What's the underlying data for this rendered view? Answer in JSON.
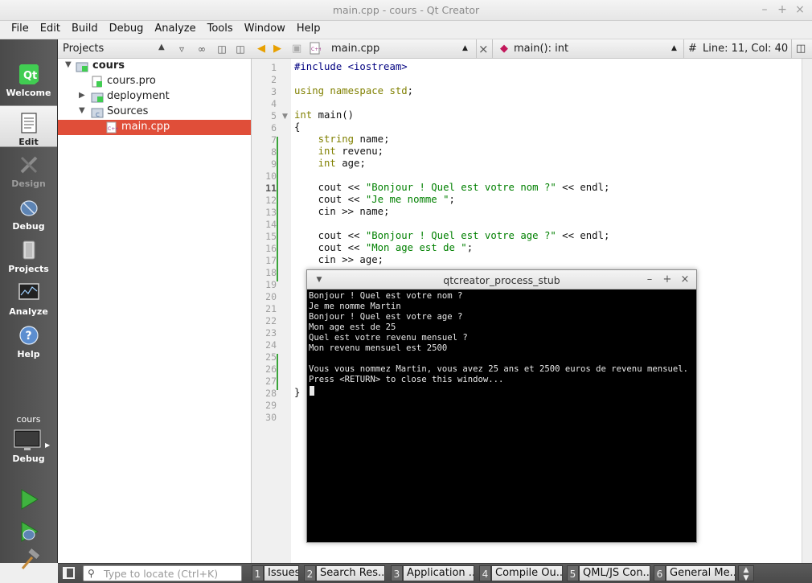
{
  "window": {
    "title": "main.cpp - cours - Qt Creator"
  },
  "menu": [
    {
      "label": "File"
    },
    {
      "label": "Edit"
    },
    {
      "label": "Build"
    },
    {
      "label": "Debug"
    },
    {
      "label": "Analyze"
    },
    {
      "label": "Tools"
    },
    {
      "label": "Window"
    },
    {
      "label": "Help"
    }
  ],
  "modes": {
    "welcome": "Welcome",
    "edit": "Edit",
    "design": "Design",
    "debug": "Debug",
    "projects": "Projects",
    "analyze": "Analyze",
    "help": "Help"
  },
  "kit": {
    "project": "cours",
    "build": "Debug"
  },
  "projects_panel": {
    "title": "Projects",
    "tree": [
      {
        "label": "cours",
        "icon": "qt-project-icon",
        "expanded": true
      },
      {
        "label": "cours.pro",
        "icon": "qt-pro-file-icon"
      },
      {
        "label": "deployment",
        "icon": "qt-folder-icon",
        "expanded": false
      },
      {
        "label": "Sources",
        "icon": "sources-folder-icon",
        "expanded": true
      },
      {
        "label": "main.cpp",
        "icon": "cpp-file-icon",
        "selected": true
      }
    ]
  },
  "editor_toolbar": {
    "file": "main.cpp",
    "symbol": "main(): int",
    "hash": "#",
    "position": "Line: 11, Col: 40"
  },
  "editor": {
    "current_line": 11,
    "lines": [
      {
        "n": "1",
        "parts": [
          {
            "t": "#include <iostream>",
            "c": "pp"
          }
        ]
      },
      {
        "n": "2",
        "parts": []
      },
      {
        "n": "3",
        "parts": [
          {
            "t": "using namespace std",
            "c": "kw"
          },
          {
            "t": ";",
            "c": ""
          }
        ]
      },
      {
        "n": "4",
        "parts": []
      },
      {
        "n": "5",
        "parts": [
          {
            "t": "int",
            "c": "kw"
          },
          {
            "t": " main()",
            "c": ""
          }
        ]
      },
      {
        "n": "6",
        "parts": [
          {
            "t": "{",
            "c": ""
          }
        ]
      },
      {
        "n": "7",
        "parts": [
          {
            "t": "    ",
            "c": ""
          },
          {
            "t": "string",
            "c": "kw"
          },
          {
            "t": " name;",
            "c": ""
          }
        ]
      },
      {
        "n": "8",
        "parts": [
          {
            "t": "    ",
            "c": ""
          },
          {
            "t": "int",
            "c": "kw"
          },
          {
            "t": " revenu;",
            "c": ""
          }
        ]
      },
      {
        "n": "9",
        "parts": [
          {
            "t": "    ",
            "c": ""
          },
          {
            "t": "int",
            "c": "kw"
          },
          {
            "t": " age;",
            "c": ""
          }
        ]
      },
      {
        "n": "10",
        "parts": []
      },
      {
        "n": "11",
        "parts": [
          {
            "t": "    cout << ",
            "c": ""
          },
          {
            "t": "\"Bonjour ! Quel est votre nom ?\"",
            "c": "str"
          },
          {
            "t": " << endl;",
            "c": ""
          }
        ]
      },
      {
        "n": "12",
        "parts": [
          {
            "t": "    cout << ",
            "c": ""
          },
          {
            "t": "\"Je me nomme \"",
            "c": "str"
          },
          {
            "t": ";",
            "c": ""
          }
        ]
      },
      {
        "n": "13",
        "parts": [
          {
            "t": "    cin >> name;",
            "c": ""
          }
        ]
      },
      {
        "n": "14",
        "parts": []
      },
      {
        "n": "15",
        "parts": [
          {
            "t": "    cout << ",
            "c": ""
          },
          {
            "t": "\"Bonjour ! Quel est votre age ?\"",
            "c": "str"
          },
          {
            "t": " << endl;",
            "c": ""
          }
        ]
      },
      {
        "n": "16",
        "parts": [
          {
            "t": "    cout << ",
            "c": ""
          },
          {
            "t": "\"Mon age est de \"",
            "c": "str"
          },
          {
            "t": ";",
            "c": ""
          }
        ]
      },
      {
        "n": "17",
        "parts": [
          {
            "t": "    cin >> age;",
            "c": ""
          }
        ]
      },
      {
        "n": "18",
        "parts": []
      },
      {
        "n": "19",
        "parts": []
      },
      {
        "n": "20",
        "parts": []
      },
      {
        "n": "21",
        "parts": []
      },
      {
        "n": "22",
        "parts": []
      },
      {
        "n": "23",
        "parts": []
      },
      {
        "n": "24",
        "parts": []
      },
      {
        "n": "25",
        "parts": []
      },
      {
        "n": "26",
        "parts": []
      },
      {
        "n": "27",
        "parts": []
      },
      {
        "n": "28",
        "parts": [
          {
            "t": "}",
            "c": ""
          }
        ]
      },
      {
        "n": "29",
        "parts": []
      },
      {
        "n": "30",
        "parts": []
      }
    ]
  },
  "terminal": {
    "title": "qtcreator_process_stub",
    "lines": [
      "Bonjour ! Quel est votre nom ?",
      "Je me nomme Martin",
      "Bonjour ! Quel est votre age ?",
      "Mon age est de 25",
      "Quel est votre revenu mensuel ?",
      "Mon revenu mensuel est 2500",
      "",
      "Vous vous nommez Martin, vous avez 25 ans et 2500 euros de revenu mensuel.",
      "Press <RETURN> to close this window..."
    ]
  },
  "statusbar": {
    "locator_placeholder": "Type to locate (Ctrl+K)",
    "tabs": [
      {
        "num": "1",
        "label": "Issues"
      },
      {
        "num": "2",
        "label": "Search Res..."
      },
      {
        "num": "3",
        "label": "Application ..."
      },
      {
        "num": "4",
        "label": "Compile Ou..."
      },
      {
        "num": "5",
        "label": "QML/JS Con..."
      },
      {
        "num": "6",
        "label": "General Me..."
      }
    ]
  }
}
